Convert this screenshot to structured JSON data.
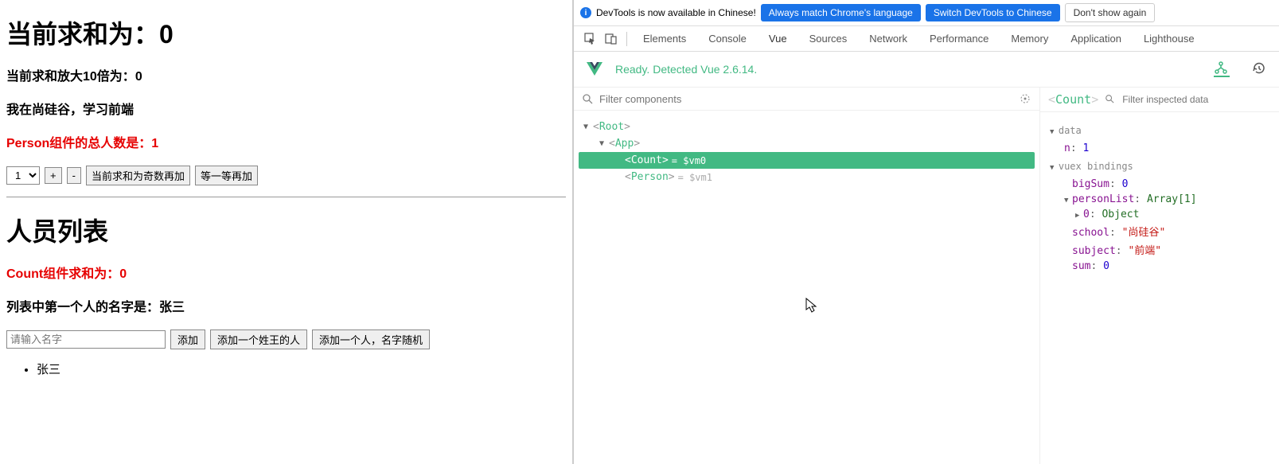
{
  "app": {
    "sum_label": "当前求和为：",
    "sum_value": "0",
    "tentimes_label": "当前求和放大10倍为：",
    "tentimes_value": "0",
    "school_line": "我在尚硅谷，学习前端",
    "person_total_label": "Person组件的总人数是：",
    "person_total_value": "1",
    "select_value": "1",
    "btn_plus": "+",
    "btn_minus": "-",
    "btn_odd": "当前求和为奇数再加",
    "btn_wait": "等一等再加",
    "list_title": "人员列表",
    "count_sum_label": "Count组件求和为：",
    "count_sum_value": "0",
    "first_name_label": "列表中第一个人的名字是：",
    "first_name_value": "张三",
    "name_placeholder": "请输入名字",
    "btn_add": "添加",
    "btn_add_wang": "添加一个姓王的人",
    "btn_add_random": "添加一个人，名字随机",
    "person_list": [
      "张三"
    ]
  },
  "devtools": {
    "notice": {
      "text": "DevTools is now available in Chinese!",
      "btn_match": "Always match Chrome's language",
      "btn_switch": "Switch DevTools to Chinese",
      "btn_dismiss": "Don't show again"
    },
    "tabs": [
      "Elements",
      "Console",
      "Vue",
      "Sources",
      "Network",
      "Performance",
      "Memory",
      "Application",
      "Lighthouse"
    ],
    "active_tab": "Vue",
    "vue_status": "Ready. Detected Vue 2.6.14.",
    "filter_placeholder": "Filter components",
    "tree": [
      {
        "name": "Root",
        "indent": 0,
        "arrow": "▼",
        "selected": false,
        "vm": ""
      },
      {
        "name": "App",
        "indent": 1,
        "arrow": "▼",
        "selected": false,
        "vm": ""
      },
      {
        "name": "Count",
        "indent": 2,
        "arrow": "",
        "selected": true,
        "vm": "= $vm0"
      },
      {
        "name": "Person",
        "indent": 2,
        "arrow": "",
        "selected": false,
        "vm": "= $vm1"
      }
    ],
    "inspect": {
      "component": "Count",
      "filter_placeholder": "Filter inspected data",
      "sections": {
        "data": [
          {
            "key": "n",
            "value": "1",
            "type": "num"
          }
        ],
        "vuex_label": "vuex bindings",
        "vuex": [
          {
            "key": "bigSum",
            "value": "0",
            "type": "num",
            "depth": 0,
            "arrow": ""
          },
          {
            "key": "personList",
            "value": "Array[1]",
            "type": "obj",
            "depth": 0,
            "arrow": "▼"
          },
          {
            "key": "0",
            "value": "Object",
            "type": "obj",
            "depth": 1,
            "arrow": "▶"
          },
          {
            "key": "school",
            "value": "\"尚硅谷\"",
            "type": "str",
            "depth": 0,
            "arrow": ""
          },
          {
            "key": "subject",
            "value": "\"前端\"",
            "type": "str",
            "depth": 0,
            "arrow": ""
          },
          {
            "key": "sum",
            "value": "0",
            "type": "num",
            "depth": 0,
            "arrow": ""
          }
        ]
      }
    }
  }
}
